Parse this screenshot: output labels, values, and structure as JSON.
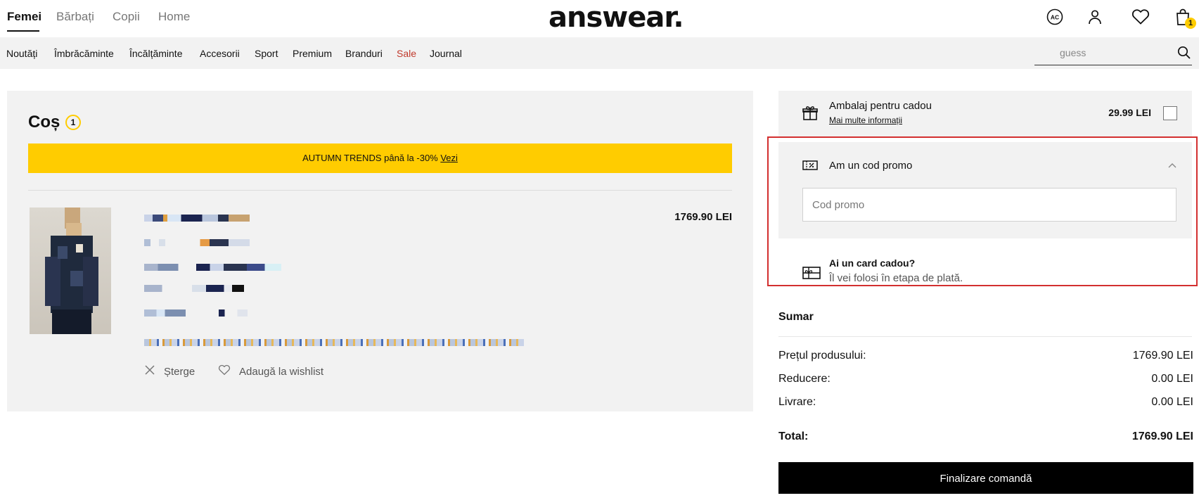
{
  "header": {
    "gender_tabs": [
      "Femei",
      "Bărbați",
      "Copii",
      "Home"
    ],
    "active_tab": "Femei",
    "logo": "answear.",
    "account_initials": "AC",
    "bag_count": "1"
  },
  "nav": {
    "categories": [
      "Noutăți",
      "Îmbrăcăminte",
      "Încălțăminte",
      "Accesorii",
      "Sport",
      "Premium",
      "Branduri",
      "Sale",
      "Journal"
    ],
    "search_placeholder": "guess"
  },
  "cart": {
    "title": "Coș",
    "count": "1",
    "banner_text": "AUTUMN TRENDS până la -30% ",
    "banner_link": "Vezi",
    "item": {
      "price": "1769.90 LEI",
      "delete_label": "Șterge",
      "wishlist_label": "Adaugă la wishlist"
    }
  },
  "sidebar": {
    "gift_wrap": {
      "title": "Ambalaj pentru cadou",
      "more_info": "Mai multe informații",
      "price": "29.99 LEI"
    },
    "promo": {
      "title": "Am un cod promo",
      "placeholder": "Cod promo"
    },
    "gift_card": {
      "title": "Ai un card cadou?",
      "subtitle": "Îl vei folosi în etapa de plată."
    },
    "summary": {
      "title": "Sumar",
      "rows": [
        {
          "label": "Prețul produsului:",
          "value": "1769.90 LEI"
        },
        {
          "label": "Reducere:",
          "value": "0.00 LEI"
        },
        {
          "label": "Livrare:",
          "value": "0.00 LEI"
        }
      ],
      "total_label": "Total:",
      "total_value": "1769.90 LEI"
    },
    "checkout_label": "Finalizare comandă"
  },
  "colors": {
    "accent_yellow": "#ffcc00",
    "sale_red": "#c0392b",
    "highlight_red": "#d32f2f",
    "panel_grey": "#f2f2f2"
  }
}
